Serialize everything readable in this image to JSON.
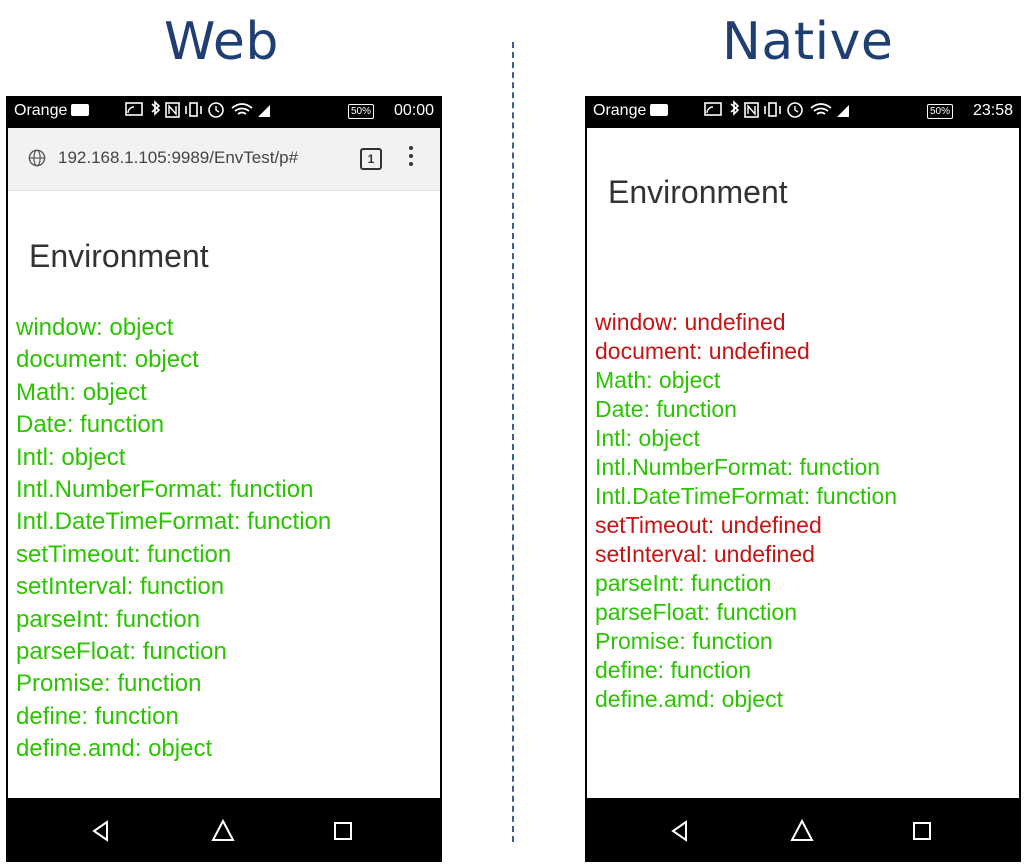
{
  "headings": {
    "web": "Web",
    "native": "Native"
  },
  "web": {
    "status": {
      "carrier": "Orange",
      "battery": "50%",
      "time": "00:00"
    },
    "url": "192.168.1.105:9989/EnvTest/p#",
    "tab_count": "1",
    "title": "Environment",
    "items": [
      {
        "text": "window: object",
        "status": "ok"
      },
      {
        "text": "document: object",
        "status": "ok"
      },
      {
        "text": "Math: object",
        "status": "ok"
      },
      {
        "text": "Date: function",
        "status": "ok"
      },
      {
        "text": "Intl: object",
        "status": "ok"
      },
      {
        "text": "Intl.NumberFormat: function",
        "status": "ok"
      },
      {
        "text": "Intl.DateTimeFormat: function",
        "status": "ok"
      },
      {
        "text": "setTimeout: function",
        "status": "ok"
      },
      {
        "text": "setInterval: function",
        "status": "ok"
      },
      {
        "text": "parseInt: function",
        "status": "ok"
      },
      {
        "text": "parseFloat: function",
        "status": "ok"
      },
      {
        "text": "Promise: function",
        "status": "ok"
      },
      {
        "text": "define: function",
        "status": "ok"
      },
      {
        "text": "define.amd: object",
        "status": "ok"
      }
    ]
  },
  "native": {
    "status": {
      "carrier": "Orange",
      "battery": "50%",
      "time": "23:58"
    },
    "title": "Environment",
    "items": [
      {
        "text": "window: undefined",
        "status": "bad"
      },
      {
        "text": "document: undefined",
        "status": "bad"
      },
      {
        "text": "Math: object",
        "status": "ok"
      },
      {
        "text": "Date: function",
        "status": "ok"
      },
      {
        "text": "Intl: object",
        "status": "ok"
      },
      {
        "text": "Intl.NumberFormat: function",
        "status": "ok"
      },
      {
        "text": "Intl.DateTimeFormat: function",
        "status": "ok"
      },
      {
        "text": "setTimeout: undefined",
        "status": "bad"
      },
      {
        "text": "setInterval: undefined",
        "status": "bad"
      },
      {
        "text": "parseInt: function",
        "status": "ok"
      },
      {
        "text": "parseFloat: function",
        "status": "ok"
      },
      {
        "text": "Promise: function",
        "status": "ok"
      },
      {
        "text": "define: function",
        "status": "ok"
      },
      {
        "text": "define.amd: object",
        "status": "ok"
      }
    ]
  },
  "colors": {
    "heading": "#1f3f73",
    "ok": "#2ac400",
    "bad": "#c41414",
    "divider": "#3a5f93"
  },
  "icons": [
    "message-icon",
    "cast-icon",
    "bluetooth-icon",
    "nfc-icon",
    "vibrate-icon",
    "alarm-icon",
    "wifi-icon",
    "signal-icon",
    "globe-icon",
    "menu-icon",
    "back-icon",
    "home-icon",
    "recent-apps-icon"
  ]
}
